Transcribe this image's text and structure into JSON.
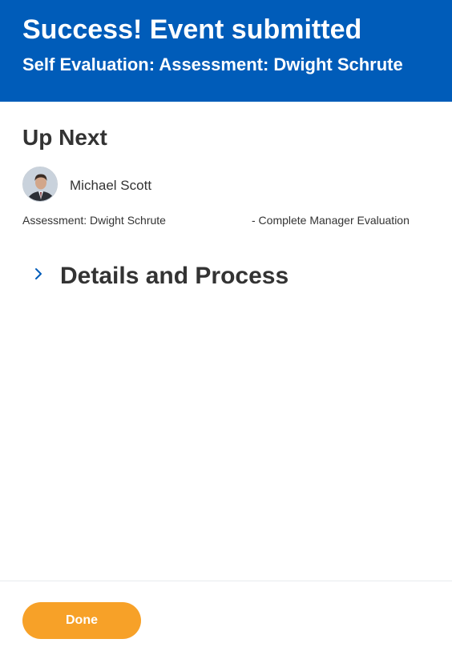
{
  "header": {
    "title": "Success! Event submitted",
    "subtitle": "Self Evaluation: Assessment: Dwight Schrute"
  },
  "up_next": {
    "heading": "Up Next",
    "person": {
      "name": "Michael Scott",
      "avatar_icon": "user-avatar-photo"
    },
    "task": {
      "left": "Assessment: Dwight Schrute",
      "right": "- Complete Manager Evaluation"
    }
  },
  "details": {
    "label": "Details and Process",
    "icon": "chevron-right-icon"
  },
  "footer": {
    "done_label": "Done"
  },
  "colors": {
    "header_bg": "#005cb9",
    "button_bg": "#f7a128",
    "chevron": "#005cb9",
    "text": "#333333"
  }
}
